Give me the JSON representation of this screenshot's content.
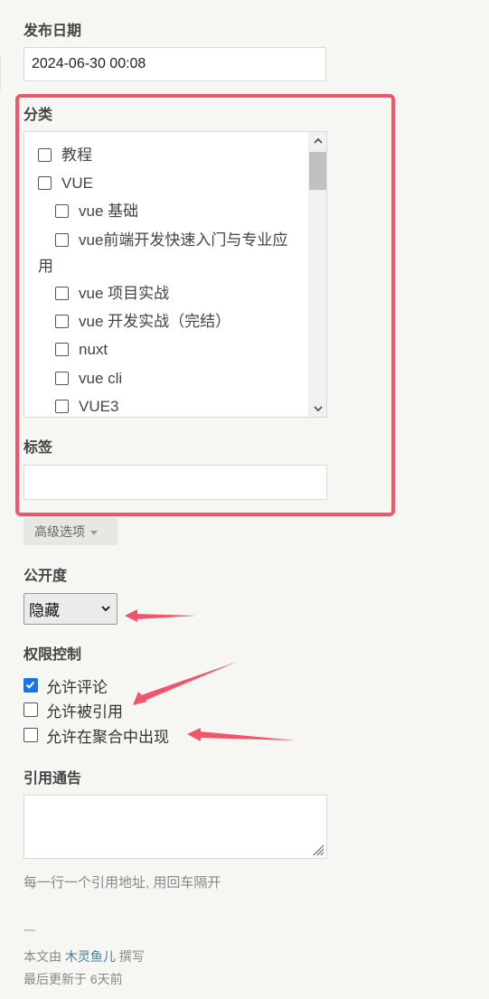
{
  "publish_date": {
    "label": "发布日期",
    "value": "2024-06-30 00:08"
  },
  "category": {
    "label": "分类",
    "items": [
      {
        "label": "教程",
        "level": 0,
        "checked": false
      },
      {
        "label": "VUE",
        "level": 0,
        "checked": false
      },
      {
        "label": "vue 基础",
        "level": 1,
        "checked": false
      },
      {
        "label": "vue前端开发快速入门与专业应",
        "label_cont": "用",
        "level": 1,
        "checked": false
      },
      {
        "label": "vue 项目实战",
        "level": 1,
        "checked": false
      },
      {
        "label": "vue 开发实战（完结）",
        "level": 1,
        "checked": false
      },
      {
        "label": "nuxt",
        "level": 1,
        "checked": false
      },
      {
        "label": "vue cli",
        "level": 1,
        "checked": false
      },
      {
        "label": "VUE3",
        "level": 1,
        "checked": false
      }
    ]
  },
  "tags": {
    "label": "标签",
    "value": ""
  },
  "advanced": {
    "label": "高级选项"
  },
  "visibility": {
    "label": "公开度",
    "selected": "隐藏"
  },
  "permissions": {
    "label": "权限控制",
    "items": [
      {
        "label": "允许评论",
        "checked": true
      },
      {
        "label": "允许被引用",
        "checked": false
      },
      {
        "label": "允许在聚合中出现",
        "checked": false
      }
    ]
  },
  "trackback": {
    "label": "引用通告",
    "value": "",
    "hint": "每一行一个引用地址, 用回车隔开"
  },
  "footer": {
    "dash": "—",
    "author_prefix": "本文由",
    "author": "木灵鱼儿",
    "author_suffix": "撰写",
    "updated": "最后更新于 6天前"
  },
  "colors": {
    "annotation": "#f0556b",
    "link": "#467b96",
    "checkbox_checked": "#1a73e8"
  }
}
